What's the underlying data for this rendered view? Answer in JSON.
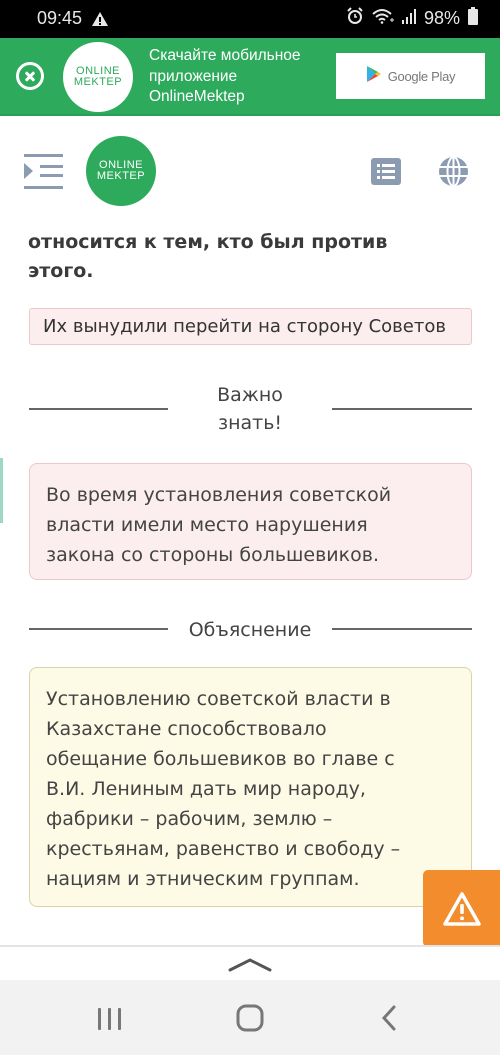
{
  "status_bar": {
    "time": "09:45",
    "battery": "98%",
    "icons": [
      "warning-icon",
      "alarm-icon",
      "wifi-icon",
      "signal-icon",
      "battery-icon"
    ]
  },
  "banner": {
    "logo_line1": "ONLINE",
    "logo_line2": "MEKTEP",
    "text_line1": "Скачайте мобильное",
    "text_line2": "приложение",
    "text_line3": "OnlineMektep",
    "store_button": "Google Play"
  },
  "header": {
    "logo_line1": "ONLINE",
    "logo_line2": "MEKTEP"
  },
  "question": {
    "text_line1": "относится к тем, кто был против",
    "text_line2": "этого.",
    "answer_value": "Их вынудили перейти на сторону Советов"
  },
  "important": {
    "title_line1": "Важно",
    "title_line2": "знать!",
    "text_lines": [
      "Во время установления советской",
      "власти имели место нарушения",
      "закона со стороны большевиков."
    ]
  },
  "explanation": {
    "title": "Объяснение",
    "text_lines": [
      "Установлению советской власти в",
      "Казахстане способствовало",
      "обещание большевиков во главе с",
      "В.И. Лениным дать мир народу,",
      "фабрики – рабочим, землю –",
      "крестьянам, равенство и свободу –",
      "нациям и этническим группам."
    ]
  },
  "colors": {
    "brand_green": "#2eaa5c",
    "report_orange": "#f28c2c",
    "wrong_answer_bg": "#fceeee",
    "explanation_bg": "#fdfbe6",
    "icon_gray": "#8a9bb2"
  }
}
